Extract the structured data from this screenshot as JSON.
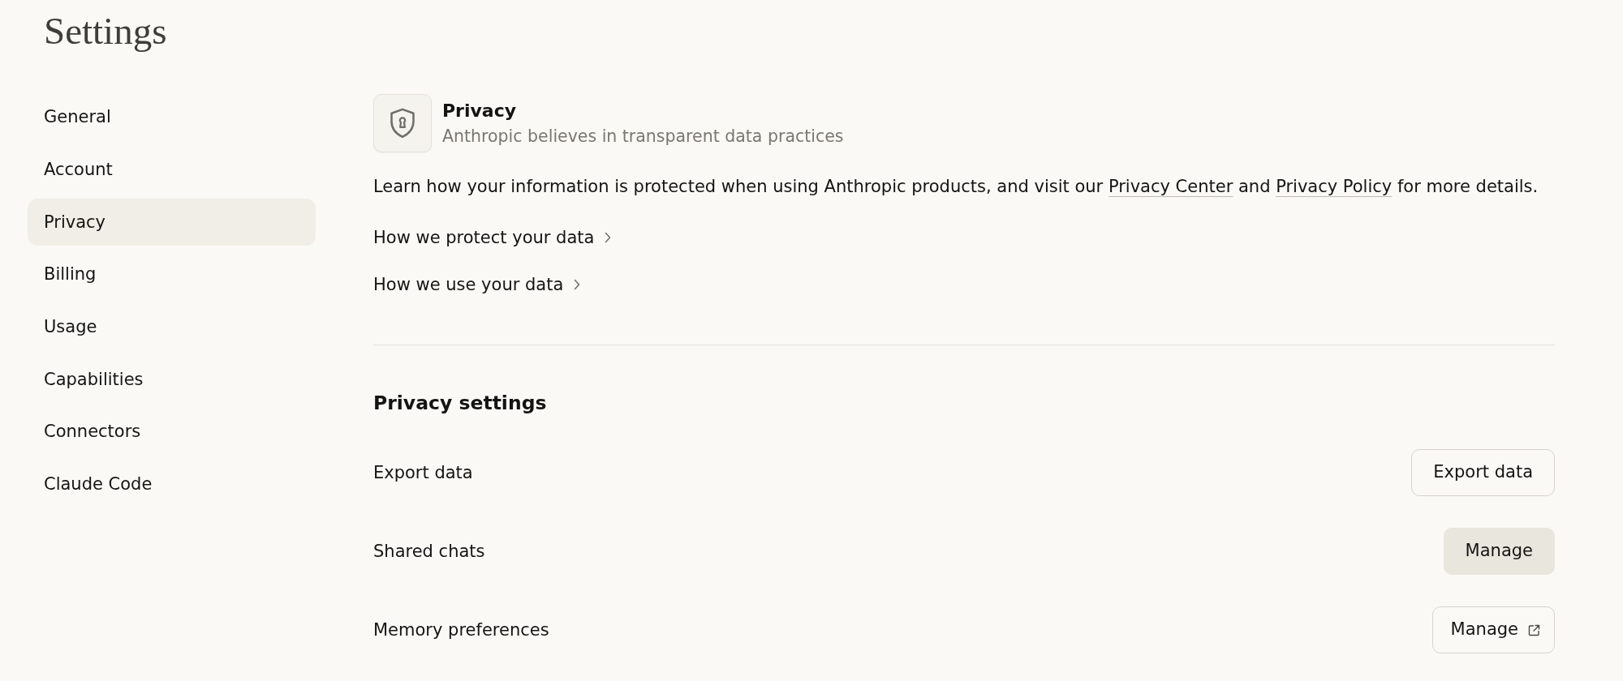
{
  "page": {
    "title": "Settings"
  },
  "sidebar": {
    "items": [
      {
        "label": "General",
        "selected": false
      },
      {
        "label": "Account",
        "selected": false
      },
      {
        "label": "Privacy",
        "selected": true
      },
      {
        "label": "Billing",
        "selected": false
      },
      {
        "label": "Usage",
        "selected": false
      },
      {
        "label": "Capabilities",
        "selected": false
      },
      {
        "label": "Connectors",
        "selected": false
      },
      {
        "label": "Claude Code",
        "selected": false
      }
    ]
  },
  "section": {
    "title": "Privacy",
    "subtitle": "Anthropic believes in transparent data practices",
    "intro": [
      {
        "kind": "text",
        "text": "Learn how your information is protected when using Anthropic products, and visit our "
      },
      {
        "kind": "link",
        "text": "Privacy Center"
      },
      {
        "kind": "text",
        "text": " and "
      },
      {
        "kind": "link",
        "text": "Privacy Policy"
      },
      {
        "kind": "text",
        "text": " for more details."
      }
    ],
    "links": [
      {
        "label": "How we protect your data"
      },
      {
        "label": "How we use your data"
      }
    ]
  },
  "privacy_settings": {
    "title": "Privacy settings",
    "rows": [
      {
        "label": "Export data",
        "button": {
          "label": "Export data",
          "kind": "outline",
          "external": false
        }
      },
      {
        "label": "Shared chats",
        "button": {
          "label": "Manage",
          "kind": "filled",
          "external": false
        }
      },
      {
        "label": "Memory preferences",
        "button": {
          "label": "Manage",
          "kind": "outline",
          "external": true
        }
      }
    ]
  }
}
